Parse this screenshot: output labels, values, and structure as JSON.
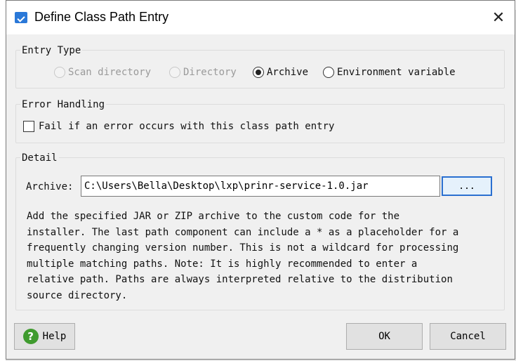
{
  "dialog": {
    "title": "Define Class Path Entry",
    "close_symbol": "✕",
    "app_icon": "dialog-app-icon"
  },
  "entry_type": {
    "legend": "Entry Type",
    "options": [
      {
        "label": "Scan directory",
        "selected": false,
        "enabled": false
      },
      {
        "label": "Directory",
        "selected": false,
        "enabled": false
      },
      {
        "label": "Archive",
        "selected": true,
        "enabled": true
      },
      {
        "label": "Environment variable",
        "selected": false,
        "enabled": true
      }
    ]
  },
  "error_handling": {
    "legend": "Error Handling",
    "fail_label": "Fail if an error occurs with this class path entry",
    "fail_checked": false
  },
  "detail": {
    "legend": "Detail",
    "archive_label": "Archive:",
    "archive_value": "C:\\Users\\Bella\\Desktop\\lxp\\prinr-service-1.0.jar",
    "browse_label": "...",
    "description": "Add the specified JAR or ZIP archive to the custom code for the\ninstaller. The last path component can include a * as a placeholder for a\nfrequently changing version number. This is not a wildcard for processing\nmultiple matching paths. Note: It is highly recommended to enter a\nrelative path. Paths are always interpreted relative to the distribution\nsource directory."
  },
  "buttons": {
    "help": "Help",
    "help_icon": "?",
    "ok": "OK",
    "cancel": "Cancel"
  }
}
